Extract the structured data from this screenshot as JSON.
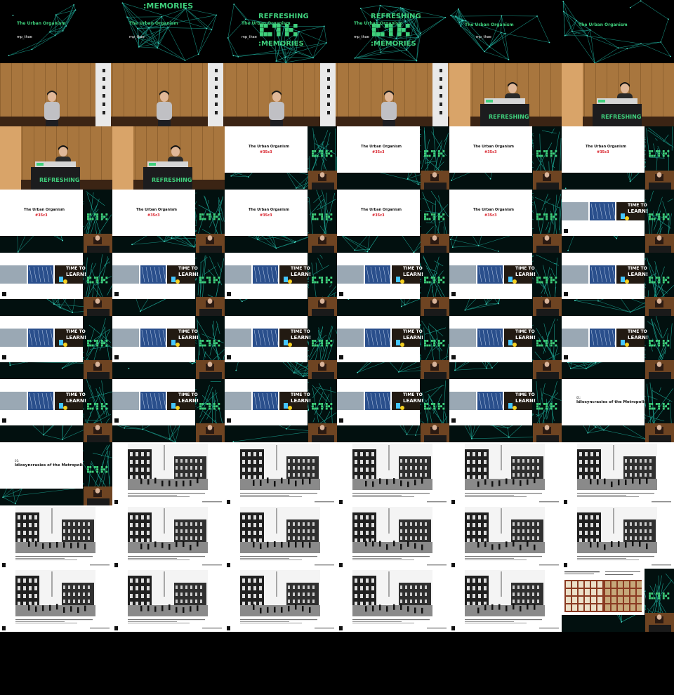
{
  "sheet": {
    "columns": 6,
    "rows": 11
  },
  "strings": {
    "intro_title": "The Urban Organism",
    "speaker": "mp_thae",
    "brand_top": "REFRESHING",
    "brand_bottom": ":MEMORIES",
    "slide_title": "The Urban Organism",
    "slide_tag": "#35c3",
    "section_number": "01:",
    "section_title": "Idiosyncrasies of the Metropolis",
    "learn_line1": "TIME TO",
    "learn_line2": "LEARN!",
    "lectern_banner": "REFRESHING",
    "side_logo_top": "REFRESHING",
    "side_logo_bottom": "MEMORIES"
  },
  "colors": {
    "accent_green": "#3fd07c",
    "network_cyan": "#1a9a8a",
    "red_tag": "#d8202a",
    "wood": "#a8763e",
    "black": "#000000",
    "white": "#ffffff"
  },
  "frames": [
    {
      "type": "intro",
      "variant": "a"
    },
    {
      "type": "intro",
      "variant": "b"
    },
    {
      "type": "intro",
      "variant": "c"
    },
    {
      "type": "intro",
      "variant": "c"
    },
    {
      "type": "intro",
      "variant": "d"
    },
    {
      "type": "intro",
      "variant": "e"
    },
    {
      "type": "stage",
      "variant": "speaker1"
    },
    {
      "type": "stage",
      "variant": "speaker1"
    },
    {
      "type": "stage",
      "variant": "speaker1"
    },
    {
      "type": "stage",
      "variant": "speaker1"
    },
    {
      "type": "stage",
      "variant": "speaker2"
    },
    {
      "type": "stage",
      "variant": "speaker2"
    },
    {
      "type": "stage",
      "variant": "speaker2"
    },
    {
      "type": "stage",
      "variant": "speaker2"
    },
    {
      "type": "title"
    },
    {
      "type": "title"
    },
    {
      "type": "title"
    },
    {
      "type": "title"
    },
    {
      "type": "title"
    },
    {
      "type": "title"
    },
    {
      "type": "title"
    },
    {
      "type": "title"
    },
    {
      "type": "title"
    },
    {
      "type": "learn"
    },
    {
      "type": "learn"
    },
    {
      "type": "learn"
    },
    {
      "type": "learn"
    },
    {
      "type": "learn"
    },
    {
      "type": "learn"
    },
    {
      "type": "learn"
    },
    {
      "type": "learn"
    },
    {
      "type": "learn"
    },
    {
      "type": "learn"
    },
    {
      "type": "learn"
    },
    {
      "type": "learn"
    },
    {
      "type": "learn"
    },
    {
      "type": "learn"
    },
    {
      "type": "learn"
    },
    {
      "type": "learn"
    },
    {
      "type": "learn"
    },
    {
      "type": "learn"
    },
    {
      "type": "section"
    },
    {
      "type": "section"
    },
    {
      "type": "photo"
    },
    {
      "type": "photo"
    },
    {
      "type": "photo"
    },
    {
      "type": "photo"
    },
    {
      "type": "photo"
    },
    {
      "type": "photo"
    },
    {
      "type": "photo"
    },
    {
      "type": "photo"
    },
    {
      "type": "photo"
    },
    {
      "type": "photo"
    },
    {
      "type": "photo"
    },
    {
      "type": "photo"
    },
    {
      "type": "photo"
    },
    {
      "type": "photo"
    },
    {
      "type": "photo"
    },
    {
      "type": "photo"
    },
    {
      "type": "grid"
    }
  ]
}
